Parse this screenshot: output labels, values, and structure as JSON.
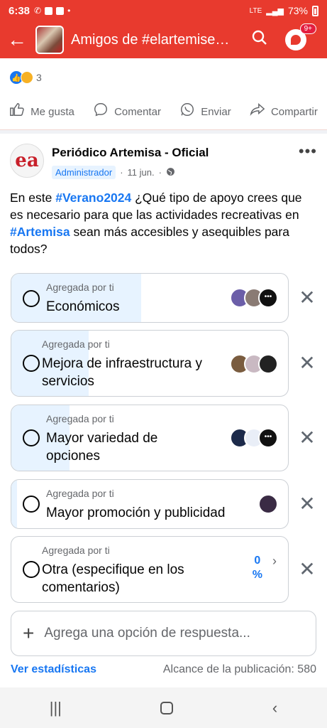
{
  "status": {
    "time": "6:38",
    "signal": "LTE",
    "battery": "73%"
  },
  "header": {
    "title": "Amigos de #elartemise…",
    "notif_count": "9+"
  },
  "reactions": {
    "count": "3"
  },
  "actions": [
    {
      "label": "Me gusta",
      "icon": "thumbs-up-icon"
    },
    {
      "label": "Comentar",
      "icon": "comment-icon"
    },
    {
      "label": "Enviar",
      "icon": "whatsapp-icon"
    },
    {
      "label": "Compartir",
      "icon": "share-icon"
    }
  ],
  "post": {
    "author": "Periódico Artemisa - Oficial",
    "avatar_text": "ea",
    "role": "Administrador",
    "date": "11 jun.",
    "text_parts": {
      "p1": "En este ",
      "tag1": "#Verano2024",
      "p2": " ¿Qué tipo de apoyo crees que es necesario para que las actividades recreativas en ",
      "tag2": "#Artemisa",
      "p3": " sean más accesibles y asequibles para todos?"
    }
  },
  "poll": {
    "options": [
      {
        "added_by": "Agregada por ti",
        "label": "Económicos",
        "fill_fraction": 0.47
      },
      {
        "added_by": "Agregada por ti",
        "label": "Mejora de infraestructura y servicios",
        "fill_fraction": 0.28
      },
      {
        "added_by": "Agregada por ti",
        "label": "Mayor variedad de opciones",
        "fill_fraction": 0.21
      },
      {
        "added_by": "Agregada por ti",
        "label": "Mayor promoción y publicidad",
        "fill_fraction": 0.02
      },
      {
        "added_by": "Agregada por ti",
        "label": "Otra (especifique en los comentarios)",
        "fill_fraction": 0,
        "percent": "0",
        "percent_sign": "%"
      }
    ],
    "add_option_placeholder": "Agrega una opción de respuesta...",
    "stats_link": "Ver estadísticas",
    "reach": "Alcance de la publicación: 580"
  },
  "colors": {
    "brand": "#e83a2e",
    "link": "#1877f2",
    "fill": "#e7f3ff"
  }
}
